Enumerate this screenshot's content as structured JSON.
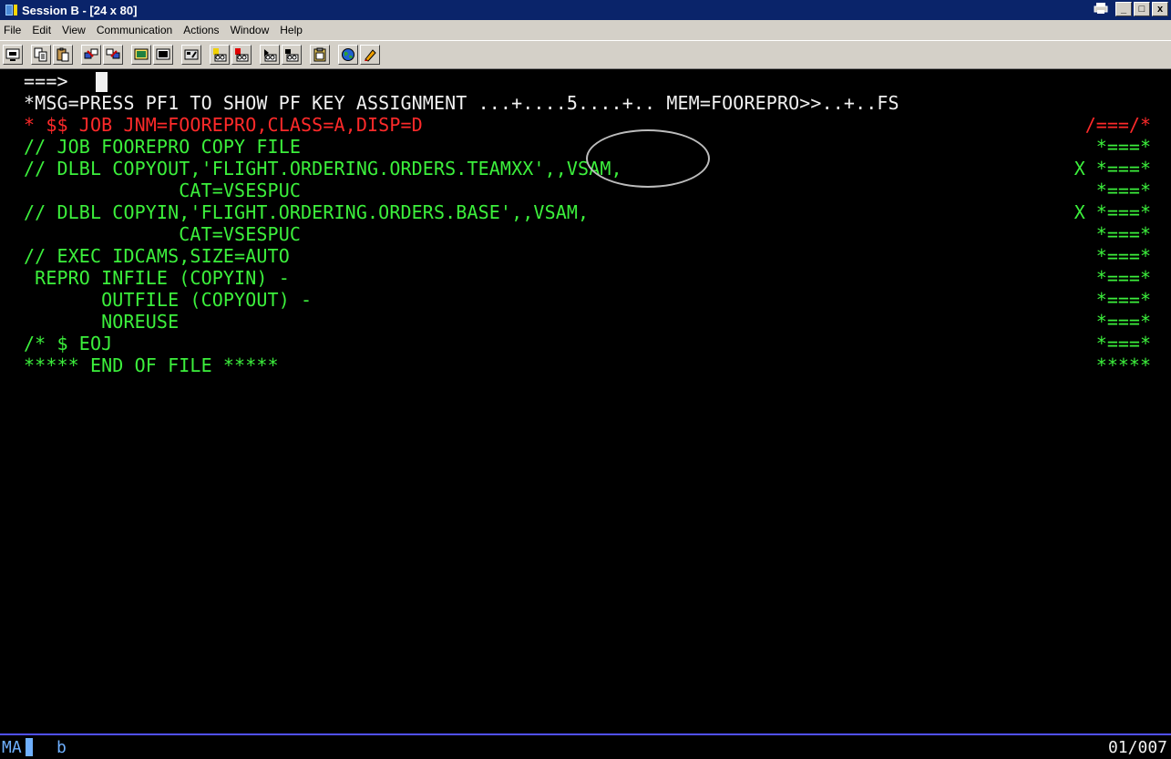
{
  "window": {
    "title": "Session B - [24 x 80]",
    "controls": {
      "minimize": "_",
      "maximize": "□",
      "close": "x"
    }
  },
  "menu": [
    "File",
    "Edit",
    "View",
    "Communication",
    "Actions",
    "Window",
    "Help"
  ],
  "toolbar": {
    "groups": [
      [
        "display-setup-icon"
      ],
      [
        "copy-icon",
        "paste-icon"
      ],
      [
        "send-file-icon",
        "receive-file-icon"
      ],
      [
        "screen-icon",
        "fullscreen-icon"
      ],
      [
        "keyboard-map-icon"
      ],
      [
        "macro-record-icon",
        "macro-play-icon"
      ],
      [
        "macro-stop-icon",
        "macro-edit-icon"
      ],
      [
        "clipboard-icon"
      ],
      [
        "globe-icon",
        "pencil-icon"
      ]
    ]
  },
  "terminal": {
    "command_prompt": "===>",
    "message_line": "*MSG=PRESS PF1 TO SHOW PF KEY ASSIGNMENT ...+....5....+.. MEM=FOOREPRO>>..+..FS",
    "lines": [
      {
        "text": "* $$ JOB JNM=FOOREPRO,CLASS=A,DISP=D",
        "right": "/===/*",
        "color": "red"
      },
      {
        "text": "// JOB FOOREPRO COPY FILE",
        "right": "*===*",
        "color": "green"
      },
      {
        "text": "// DLBL COPYOUT,'FLIGHT.ORDERING.ORDERS.TEAMXX',,VSAM,",
        "right": "X *===*",
        "color": "green"
      },
      {
        "text": "              CAT=VSESPUC",
        "right": "*===*",
        "color": "green"
      },
      {
        "text": "// DLBL COPYIN,'FLIGHT.ORDERING.ORDERS.BASE',,VSAM,",
        "right": "X *===*",
        "color": "green"
      },
      {
        "text": "              CAT=VSESPUC",
        "right": "*===*",
        "color": "green"
      },
      {
        "text": "// EXEC IDCAMS,SIZE=AUTO",
        "right": "*===*",
        "color": "green"
      },
      {
        "text": " REPRO INFILE (COPYIN) -",
        "right": "*===*",
        "color": "green"
      },
      {
        "text": "       OUTFILE (COPYOUT) -",
        "right": "*===*",
        "color": "green"
      },
      {
        "text": "       NOREUSE",
        "right": "*===*",
        "color": "green"
      },
      {
        "text": "/* $ EOJ",
        "right": "*===*",
        "color": "green"
      },
      {
        "text": "***** END OF FILE *****",
        "right": "*****",
        "color": "green"
      }
    ]
  },
  "status": {
    "mode": "MA",
    "indicator": "b",
    "cursor_position": "01/007"
  }
}
